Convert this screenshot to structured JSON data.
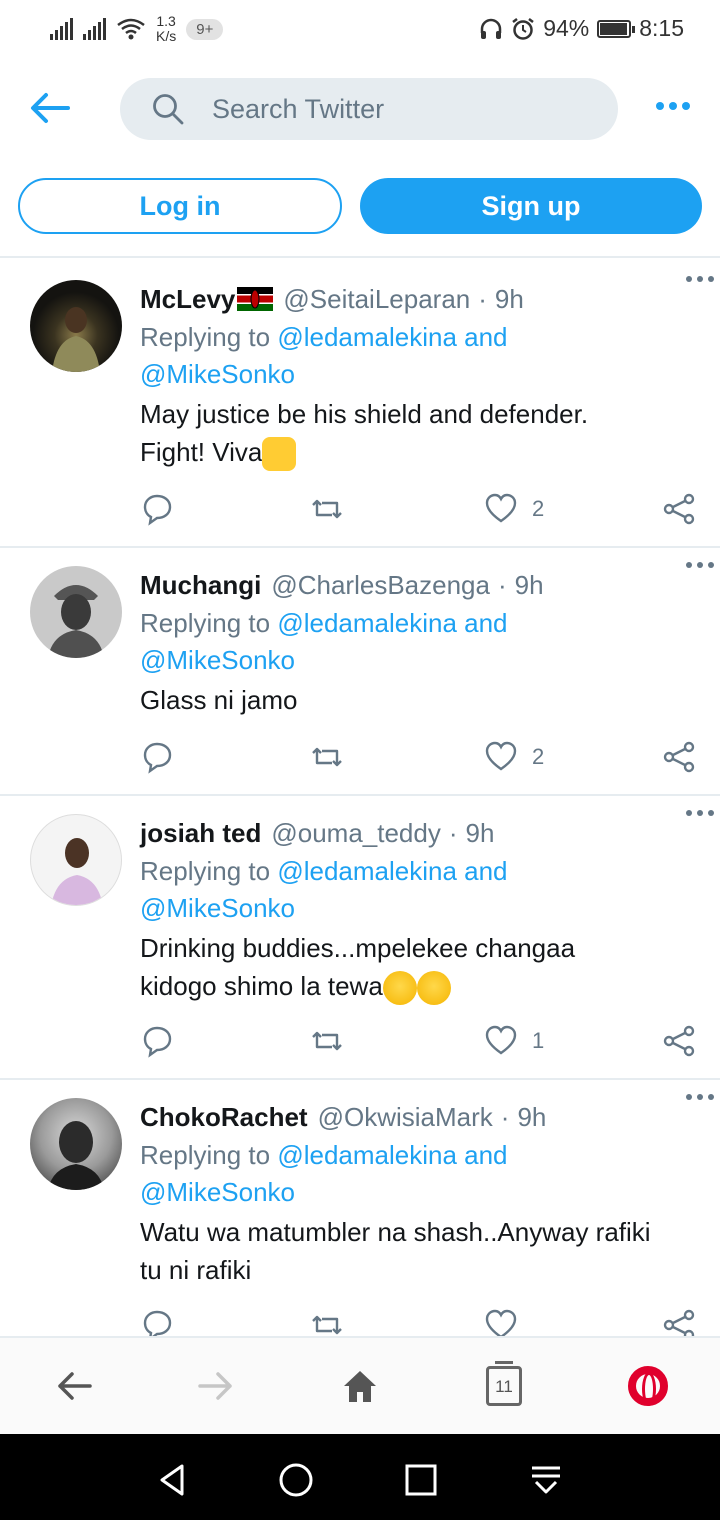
{
  "status_bar": {
    "net_speed_value": "1.3",
    "net_speed_unit": "K/s",
    "notification_badge": "9+",
    "battery": "94%",
    "battery_level": 0.94,
    "time": "8:15"
  },
  "header": {
    "search_placeholder": "Search Twitter",
    "login_label": "Log in",
    "signup_label": "Sign up"
  },
  "colors": {
    "accent": "#1da1f2",
    "secondary_text": "#657786",
    "divider": "#e6ecf0"
  },
  "tweets": [
    {
      "name": "McLevy",
      "handle": "@SeitaiLeparan",
      "time": "9h",
      "replying_prefix": "Replying to",
      "reply_to_1": "@ledamalekina and",
      "reply_to_2": "@MikeSonko",
      "text_line_1": "May justice be his shield and defender.",
      "text_line_2": "Fight! Viva",
      "likes": "2",
      "icons": [
        "kenya-flag-icon",
        "raised-fist-emoji"
      ]
    },
    {
      "name": "Muchangi",
      "handle": "@CharlesBazenga",
      "time": "9h",
      "replying_prefix": "Replying to",
      "reply_to_1": "@ledamalekina and",
      "reply_to_2": "@MikeSonko",
      "text_line_1": "Glass ni jamo",
      "likes": "2"
    },
    {
      "name": "josiah ted",
      "handle": "@ouma_teddy",
      "time": "9h",
      "replying_prefix": "Replying to",
      "reply_to_1": "@ledamalekina and",
      "reply_to_2": "@MikeSonko",
      "text_line_1": "Drinking buddies...mpelekee changaa",
      "text_line_2": "kidogo shimo la tewa",
      "likes": "1",
      "icons": [
        "rolling-laughing-emoji",
        "rolling-laughing-emoji"
      ]
    },
    {
      "name": "ChokoRachet",
      "handle": "@OkwisiaMark",
      "time": "9h",
      "replying_prefix": "Replying to",
      "reply_to_1": "@ledamalekina and",
      "reply_to_2": "@MikeSonko",
      "text_line_1": "Watu wa matumbler na shash..Anyway rafiki",
      "text_line_2": "tu ni rafiki"
    }
  ],
  "browser_bar": {
    "tab_count": "11"
  }
}
